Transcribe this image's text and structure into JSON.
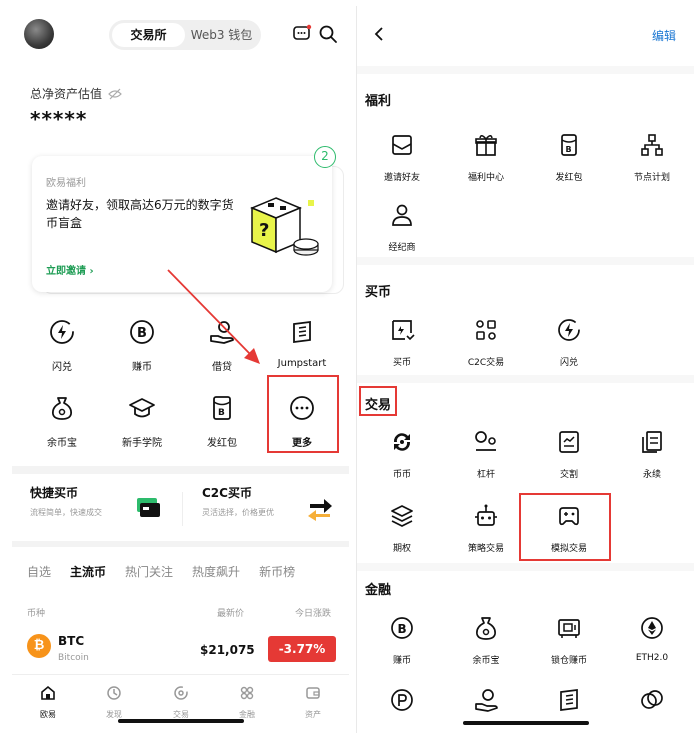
{
  "left": {
    "segments": [
      "交易所",
      "Web3 钱包"
    ],
    "asset": {
      "label": "总净资产估值",
      "value": "*****"
    },
    "promo": {
      "tag": "欧易福利",
      "title": "邀请好友，领取高达6万元的数字货币盲盒",
      "cta": "立即邀请 ›",
      "count": "2"
    },
    "grid": [
      {
        "label": "闪兑"
      },
      {
        "label": "赚币"
      },
      {
        "label": "借贷"
      },
      {
        "label": "Jumpstart"
      },
      {
        "label": "余币宝"
      },
      {
        "label": "新手学院"
      },
      {
        "label": "发红包"
      },
      {
        "label": "更多"
      }
    ],
    "quick": [
      {
        "title": "快捷买币",
        "sub": "流程简单，快速成交"
      },
      {
        "title": "C2C买币",
        "sub": "灵活选择，价格更优"
      }
    ],
    "tabs": [
      "自选",
      "主流币",
      "热门关注",
      "热度飙升",
      "新币榜"
    ],
    "table_head": {
      "col1": "币种",
      "col2": "最新价",
      "col3": "今日涨跌"
    },
    "row": {
      "symbol": "BTC",
      "name": "Bitcoin",
      "price": "$21,075",
      "change": "-3.77%"
    },
    "nav": [
      "欧易",
      "发现",
      "交易",
      "金融",
      "资产"
    ]
  },
  "right": {
    "edit": "编辑",
    "sections": [
      {
        "title": "福利",
        "items": [
          "邀请好友",
          "福利中心",
          "发红包",
          "节点计划",
          "经纪商"
        ]
      },
      {
        "title": "买币",
        "items": [
          "买币",
          "C2C交易",
          "闪兑"
        ]
      },
      {
        "title": "交易",
        "items": [
          "币币",
          "杠杆",
          "交割",
          "永续",
          "期权",
          "策略交易",
          "模拟交易"
        ]
      },
      {
        "title": "金融",
        "items": [
          "赚币",
          "余币宝",
          "锁仓赚币",
          "ETH2.0"
        ]
      }
    ]
  },
  "colors": {
    "accent_green": "#2dbb6c",
    "highlight_red": "#e53935",
    "link_blue": "#1976d2",
    "btc_orange": "#f7931a"
  }
}
